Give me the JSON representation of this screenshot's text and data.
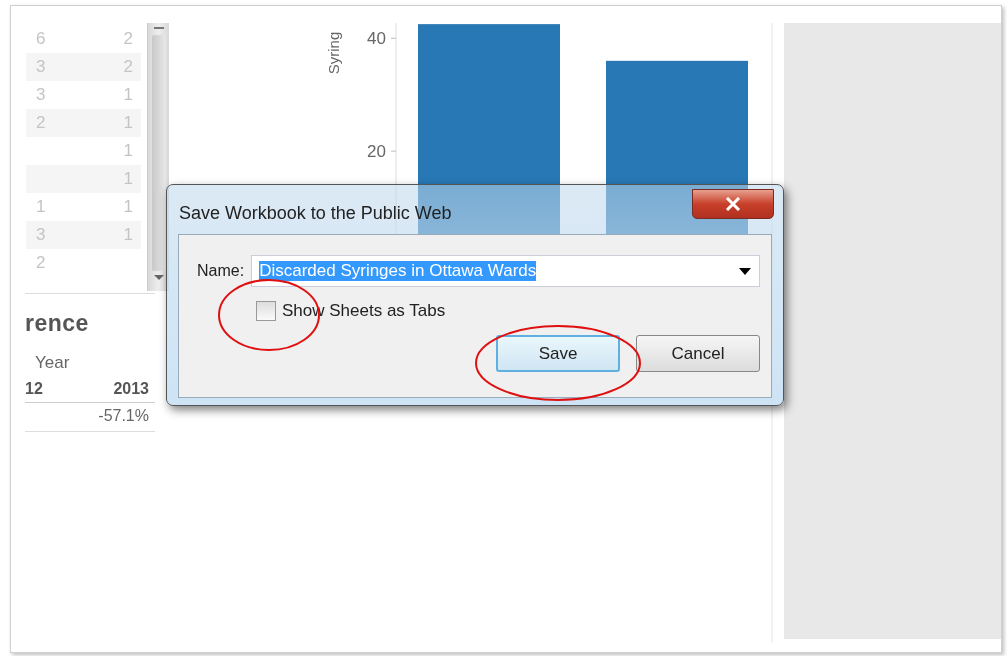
{
  "table": {
    "rows": [
      {
        "cells": [
          "6",
          "2"
        ]
      },
      {
        "cells": [
          "3",
          "2"
        ]
      },
      {
        "cells": [
          "3",
          "1"
        ]
      },
      {
        "cells": [
          "2",
          "1"
        ]
      },
      {
        "cells": [
          null,
          "1"
        ]
      },
      {
        "cells": [
          null,
          "1"
        ]
      },
      {
        "cells": [
          "1",
          "1"
        ]
      },
      {
        "cells": [
          "3",
          "1"
        ]
      },
      {
        "cells": [
          "2",
          null
        ]
      }
    ]
  },
  "difference": {
    "title": "rence",
    "header": "Year",
    "columns": [
      "12",
      "2013"
    ],
    "values": [
      "-57.1%"
    ]
  },
  "chart_data": {
    "type": "bar",
    "ylabel": "Syring",
    "values": [
      42.5,
      36
    ],
    "yticks": [
      20,
      40
    ],
    "ylim": [
      0,
      42.7
    ],
    "color": "#2878b5"
  },
  "dialog": {
    "title": "Save Workbook to the Public Web",
    "name_label": "Name:",
    "name_value": "Discarded Syringes in Ottawa Wards",
    "value_selected": true,
    "checkbox": {
      "label": "Show Sheets as Tabs",
      "checked": false,
      "highlighted": true
    },
    "buttons": [
      {
        "label": "Save",
        "focused": true,
        "highlighted": true
      },
      {
        "label": "Cancel",
        "focused": false,
        "highlighted": false
      }
    ]
  }
}
